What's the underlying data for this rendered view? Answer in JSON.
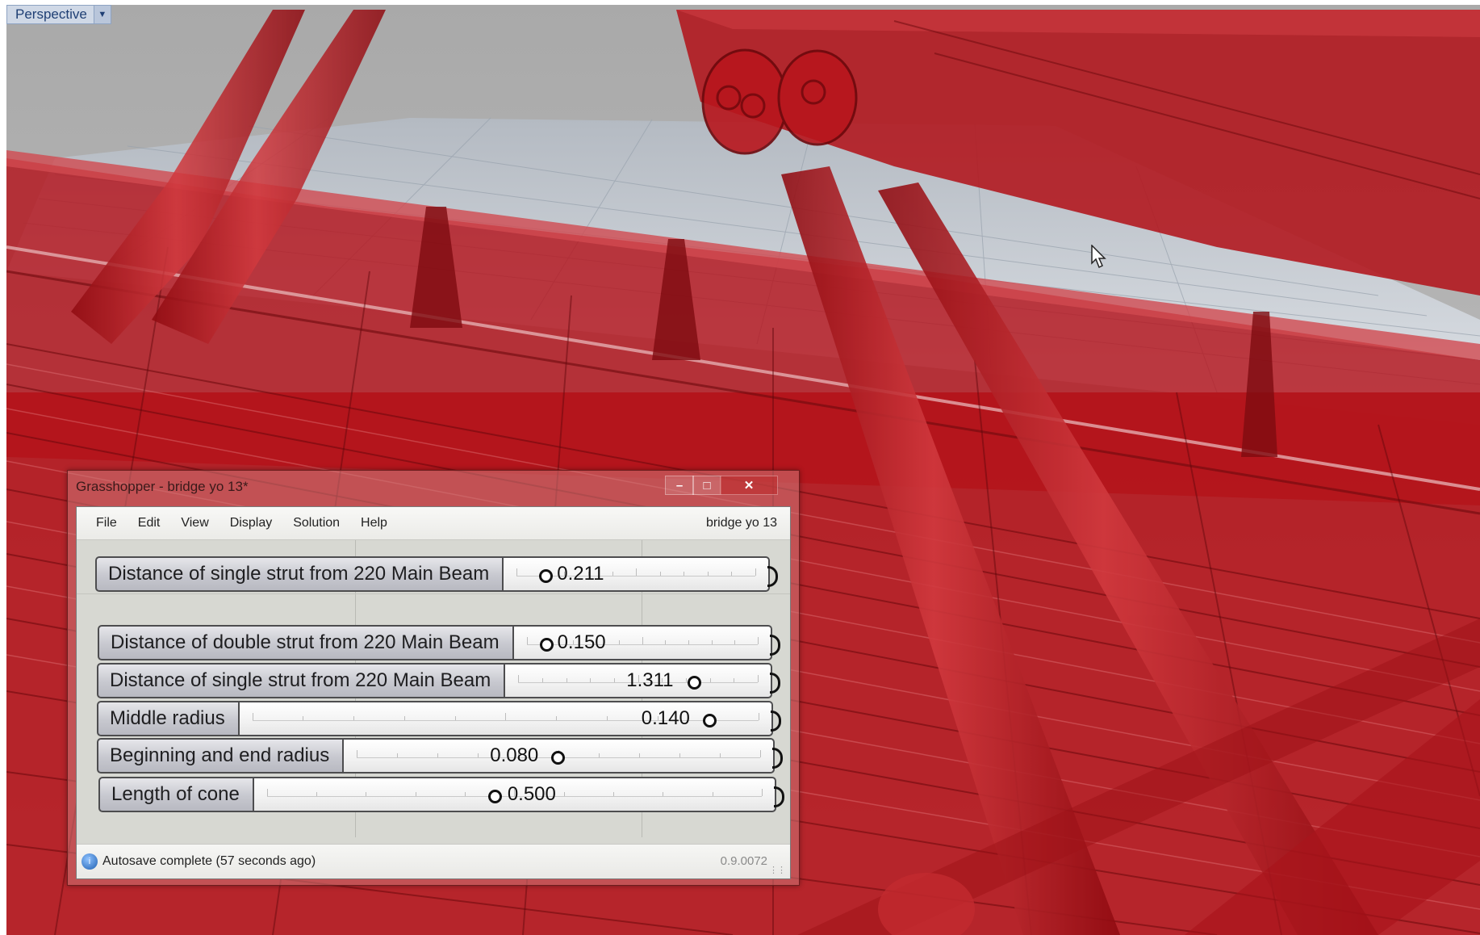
{
  "viewport": {
    "label": "Perspective",
    "dropdown_icon": "chevron-down-icon"
  },
  "grasshopper": {
    "title": "Grasshopper - bridge yo 13*",
    "window_controls": {
      "minimize": "–",
      "maximize": "□",
      "close": "✕"
    },
    "menu": [
      "File",
      "Edit",
      "View",
      "Display",
      "Solution",
      "Help"
    ],
    "document_name": "bridge yo 13",
    "sliders": [
      {
        "label": "Distance of single strut from 220 Main Beam",
        "value": "0.211",
        "fraction": 0.05,
        "value_side": "right"
      },
      {
        "label": "Distance of double strut from 220 Main Beam",
        "value": "0.150",
        "fraction": 0.05,
        "value_side": "right"
      },
      {
        "label": "Distance of single strut from 220 Main Beam",
        "value": "1.311",
        "fraction": 0.83,
        "value_side": "left"
      },
      {
        "label": "Middle radius",
        "value": "0.140",
        "fraction": 0.92,
        "value_side": "left"
      },
      {
        "label": "Beginning and end radius",
        "value": "0.080",
        "fraction": 0.53,
        "value_side": "left"
      },
      {
        "label": "Length of cone",
        "value": "0.500",
        "fraction": 0.47,
        "value_side": "right"
      }
    ],
    "status": {
      "icon": "grasshopper-info-icon",
      "text": "Autosave complete (57 seconds ago)",
      "version": "0.9.0072"
    }
  },
  "colors": {
    "model_red": "#b8121a",
    "model_dark_red": "#7a0a10",
    "sky_gray": "#b9b9b9",
    "grid_blue": "#aab2bd"
  }
}
